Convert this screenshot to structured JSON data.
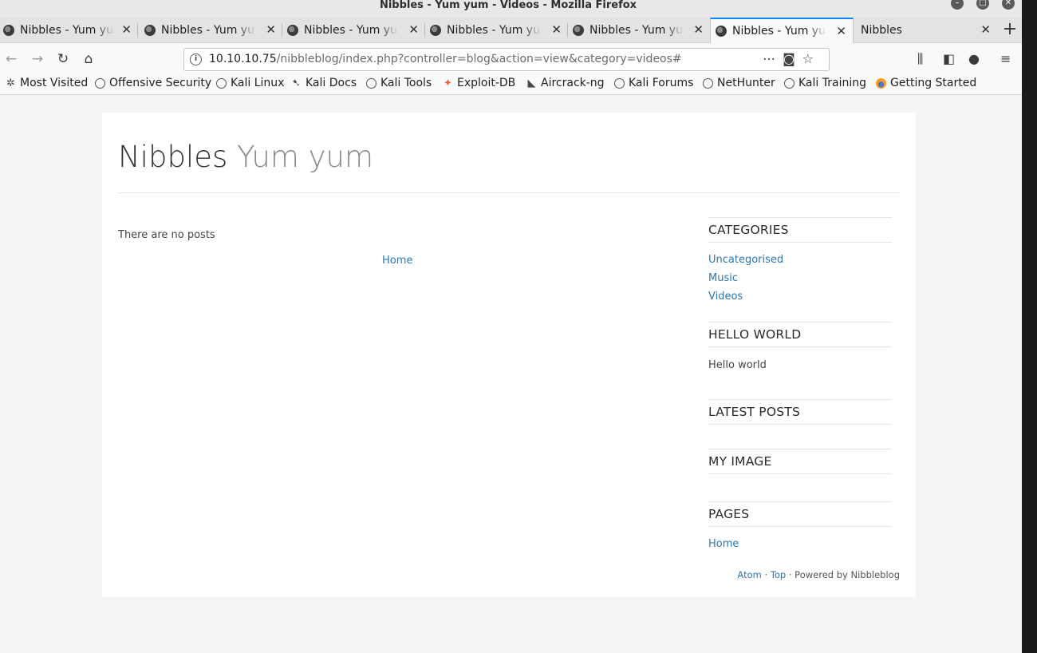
{
  "window": {
    "title": "Nibbles - Yum yum - Videos - Mozilla Firefox"
  },
  "tabs": [
    {
      "label": "Nibbles - Yum yum - Videos",
      "active": false
    },
    {
      "label": "Nibbles - Yum yum - Videos",
      "active": false
    },
    {
      "label": "Nibbles - Yum yum - Videos",
      "active": false
    },
    {
      "label": "Nibbles - Yum yum - Videos",
      "active": false
    },
    {
      "label": "Nibbles - Yum yum - Videos",
      "active": false
    },
    {
      "label": "Nibbles - Yum yum - Videos",
      "active": true
    },
    {
      "label": "Nibbles",
      "active": false
    }
  ],
  "address": {
    "host": "10.10.10.75",
    "path": "/nibbleblog/index.php?controller=blog&action=view&category=videos#"
  },
  "bookmarks": [
    {
      "label": "Most Visited",
      "icon": "gear-icon"
    },
    {
      "label": "Offensive Security",
      "icon": "globe-icon"
    },
    {
      "label": "Kali Linux",
      "icon": "globe-icon"
    },
    {
      "label": "Kali Docs",
      "icon": "kali-dragon-icon"
    },
    {
      "label": "Kali Tools",
      "icon": "globe-icon"
    },
    {
      "label": "Exploit-DB",
      "icon": "exploitdb-icon"
    },
    {
      "label": "Aircrack-ng",
      "icon": "aircrack-icon"
    },
    {
      "label": "Kali Forums",
      "icon": "globe-icon"
    },
    {
      "label": "NetHunter",
      "icon": "globe-icon"
    },
    {
      "label": "Kali Training",
      "icon": "globe-icon"
    },
    {
      "label": "Getting Started",
      "icon": "firefox-icon"
    }
  ],
  "site": {
    "title": "Nibbles",
    "slogan": "Yum yum",
    "no_posts": "There are no posts",
    "home_link": "Home"
  },
  "sidebar": {
    "categories_heading": "CATEGORIES",
    "categories": [
      "Uncategorised",
      "Music",
      "Videos"
    ],
    "hello_heading": "HELLO WORLD",
    "hello_text": "Hello world",
    "latest_heading": "LATEST POSTS",
    "image_heading": "MY IMAGE",
    "pages_heading": "PAGES",
    "pages": [
      "Home"
    ]
  },
  "footer": {
    "atom": "Atom",
    "sep1": " · ",
    "top": "Top",
    "powered": " · Powered by Nibbleblog"
  },
  "colors": {
    "link": "#2a77b6",
    "tab_accent": "#0a84ff"
  }
}
